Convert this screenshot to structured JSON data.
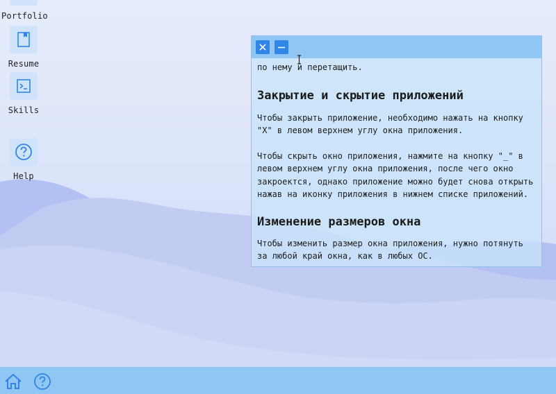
{
  "desktop": {
    "icons": [
      {
        "label": "Portfolio",
        "icon": "briefcase-icon"
      },
      {
        "label": "Resume",
        "icon": "book-icon"
      },
      {
        "label": "Skills",
        "icon": "terminal-icon"
      },
      {
        "label": "Help",
        "icon": "help-circle-icon"
      }
    ]
  },
  "window": {
    "close_label": "X",
    "minimize_label": "—",
    "intro_tail": "по нему и перетащить.",
    "sections": [
      {
        "heading": "Закрытие и скрытие приложений",
        "paragraphs": [
          "Чтобы закрыть приложение, необходимо нажать на кнопку \"X\" в левом верхнем углу окна приложения.",
          "Чтобы скрыть окно приложения, нажмите на кнопку \"_\" в левом верхнем углу окна приложения, после чего окно закроектся, однако приложение можно будет снова открыть нажав на иконку приложения в нижнем списке приложений."
        ]
      },
      {
        "heading": "Изменение размеров окна",
        "paragraphs": [
          "Чтобы изменить размер окна приложения, нужно потянуть за любой край окна, как в любых ОС."
        ]
      }
    ]
  },
  "taskbar": {
    "items": [
      {
        "icon": "home-icon"
      },
      {
        "icon": "help-circle-icon"
      }
    ]
  },
  "colors": {
    "accent": "#2f86e6",
    "titlebar": "#8fc6f3",
    "taskbar": "#8fc6f3",
    "icon_tile": "#cfe3fb"
  }
}
